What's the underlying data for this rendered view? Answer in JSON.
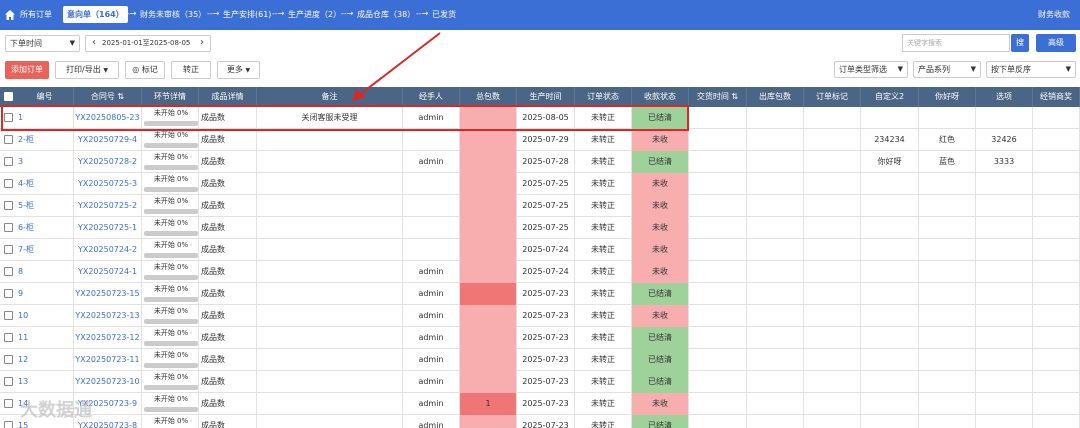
{
  "nav": {
    "items": [
      {
        "label": "所有订单"
      },
      {
        "label": "意向单（164）"
      },
      {
        "label": "财务未审核（35）"
      },
      {
        "label": "生产安排(61)"
      },
      {
        "label": "生产进度（2）"
      },
      {
        "label": "成品仓库（38）"
      },
      {
        "label": "已发货"
      }
    ],
    "arrow": "--→",
    "right_label": "财务收款"
  },
  "filter": {
    "time_select": "下单时间",
    "date_range": "2025-01-01至2025-08-05",
    "prev": "‹",
    "next": "›",
    "search_placeholder": "关键字搜索",
    "search_button": "搜",
    "advanced_button": "高级"
  },
  "toolbar": {
    "add_order": "添加订单",
    "print_export": "打印/导出",
    "mark": "标记",
    "transfer": "转正",
    "more": "更多",
    "order_type_filter": "订单类型筛选",
    "product_series": "产品系列",
    "sort_order": "按下单反序"
  },
  "table": {
    "columns": [
      "编号",
      "合同号",
      "环节详情",
      "成品详情",
      "备注",
      "经手人",
      "总包数",
      "生产时间",
      "订单状态",
      "收款状态",
      "交货时间",
      "出库包数",
      "订单标记",
      "自定义2",
      "你好呀",
      "选项",
      "经销商奖"
    ],
    "rows": [
      {
        "id": "1",
        "contract": "YX20250805-23",
        "progress_label": "未开始 0%",
        "progress": 0,
        "product": "成品数",
        "remark": "关闭客服未受理",
        "handler": "admin",
        "packages": "",
        "pkg_color": "pink",
        "prod_date": "2025-08-05",
        "status": "未转正",
        "payment": "已结清",
        "pay_color": "green",
        "custom2": "",
        "nihao": "",
        "option": ""
      },
      {
        "id": "2-柜",
        "contract": "YX20250729-4",
        "progress_label": "未开始 0%",
        "progress": 0,
        "product": "成品数",
        "remark": "",
        "handler": "",
        "packages": "",
        "pkg_color": "pink",
        "prod_date": "2025-07-29",
        "status": "未转正",
        "payment": "未收",
        "pay_color": "pink",
        "custom2": "234234",
        "nihao": "红色",
        "option": "32426"
      },
      {
        "id": "3",
        "contract": "YX20250728-2",
        "progress_label": "未开始 0%",
        "progress": 0,
        "product": "成品数",
        "remark": "",
        "handler": "admin",
        "packages": "",
        "pkg_color": "pink",
        "prod_date": "2025-07-28",
        "status": "未转正",
        "payment": "已结清",
        "pay_color": "green",
        "custom2": "你好呀",
        "nihao": "蓝色",
        "option": "3333"
      },
      {
        "id": "4-柜",
        "contract": "YX20250725-3",
        "progress_label": "未开始 0%",
        "progress": 0,
        "product": "成品数",
        "remark": "",
        "handler": "",
        "packages": "",
        "pkg_color": "pink",
        "prod_date": "2025-07-25",
        "status": "未转正",
        "payment": "未收",
        "pay_color": "pink",
        "custom2": "",
        "nihao": "",
        "option": ""
      },
      {
        "id": "5-柜",
        "contract": "YX20250725-2",
        "progress_label": "未开始 0%",
        "progress": 0,
        "product": "成品数",
        "remark": "",
        "handler": "",
        "packages": "",
        "pkg_color": "pink",
        "prod_date": "2025-07-25",
        "status": "未转正",
        "payment": "未收",
        "pay_color": "pink",
        "custom2": "",
        "nihao": "",
        "option": ""
      },
      {
        "id": "6-柜",
        "contract": "YX20250725-1",
        "progress_label": "未开始 0%",
        "progress": 0,
        "product": "成品数",
        "remark": "",
        "handler": "",
        "packages": "",
        "pkg_color": "pink",
        "prod_date": "2025-07-25",
        "status": "未转正",
        "payment": "未收",
        "pay_color": "pink",
        "custom2": "",
        "nihao": "",
        "option": ""
      },
      {
        "id": "7-柜",
        "contract": "YX20250724-2",
        "progress_label": "未开始 0%",
        "progress": 0,
        "product": "成品数",
        "remark": "",
        "handler": "",
        "packages": "",
        "pkg_color": "pink",
        "prod_date": "2025-07-24",
        "status": "未转正",
        "payment": "未收",
        "pay_color": "pink",
        "custom2": "",
        "nihao": "",
        "option": ""
      },
      {
        "id": "8",
        "contract": "YX20250724-1",
        "progress_label": "未开始 0%",
        "progress": 0,
        "product": "成品数",
        "remark": "",
        "handler": "admin",
        "packages": "",
        "pkg_color": "pink",
        "prod_date": "2025-07-24",
        "status": "未转正",
        "payment": "未收",
        "pay_color": "pink",
        "custom2": "",
        "nihao": "",
        "option": ""
      },
      {
        "id": "9",
        "contract": "YX20250723-15",
        "progress_label": "未开始 0%",
        "progress": 0,
        "product": "成品数",
        "remark": "",
        "handler": "admin",
        "packages": "",
        "pkg_color": "red",
        "prod_date": "2025-07-23",
        "status": "未转正",
        "payment": "已结清",
        "pay_color": "green",
        "custom2": "",
        "nihao": "",
        "option": ""
      },
      {
        "id": "10",
        "contract": "YX20250723-13",
        "progress_label": "未开始 0%",
        "progress": 0,
        "product": "成品数",
        "remark": "",
        "handler": "admin",
        "packages": "",
        "pkg_color": "pink",
        "prod_date": "2025-07-23",
        "status": "未转正",
        "payment": "未收",
        "pay_color": "pink",
        "custom2": "",
        "nihao": "",
        "option": ""
      },
      {
        "id": "11",
        "contract": "YX20250723-12",
        "progress_label": "未开始 0%",
        "progress": 0,
        "product": "成品数",
        "remark": "",
        "handler": "admin",
        "packages": "",
        "pkg_color": "pink",
        "prod_date": "2025-07-23",
        "status": "未转正",
        "payment": "已结清",
        "pay_color": "green",
        "custom2": "",
        "nihao": "",
        "option": ""
      },
      {
        "id": "12",
        "contract": "YX20250723-11",
        "progress_label": "未开始 0%",
        "progress": 0,
        "product": "成品数",
        "remark": "",
        "handler": "admin",
        "packages": "",
        "pkg_color": "pink",
        "prod_date": "2025-07-23",
        "status": "未转正",
        "payment": "已结清",
        "pay_color": "green",
        "custom2": "",
        "nihao": "",
        "option": ""
      },
      {
        "id": "13",
        "contract": "YX20250723-10",
        "progress_label": "未开始 0%",
        "progress": 0,
        "product": "成品数",
        "remark": "",
        "handler": "admin",
        "packages": "",
        "pkg_color": "pink",
        "prod_date": "2025-07-23",
        "status": "未转正",
        "payment": "已结清",
        "pay_color": "green",
        "custom2": "",
        "nihao": "",
        "option": ""
      },
      {
        "id": "14",
        "contract": "YX20250723-9",
        "progress_label": "未开始 0%",
        "progress": 0,
        "product": "成品数",
        "remark": "",
        "handler": "admin",
        "packages": "1",
        "pkg_color": "red",
        "prod_date": "2025-07-23",
        "status": "未转正",
        "payment": "未收",
        "pay_color": "pink",
        "custom2": "",
        "nihao": "",
        "option": ""
      },
      {
        "id": "15",
        "contract": "YX20250723-8",
        "progress_label": "未开始 0%",
        "progress": 0,
        "product": "成品数",
        "remark": "",
        "handler": "admin",
        "packages": "",
        "pkg_color": "pink",
        "prod_date": "2025-07-23",
        "status": "未转正",
        "payment": "已结清",
        "pay_color": "green",
        "custom2": "",
        "nihao": "",
        "option": ""
      }
    ]
  },
  "watermark": "大数据通"
}
